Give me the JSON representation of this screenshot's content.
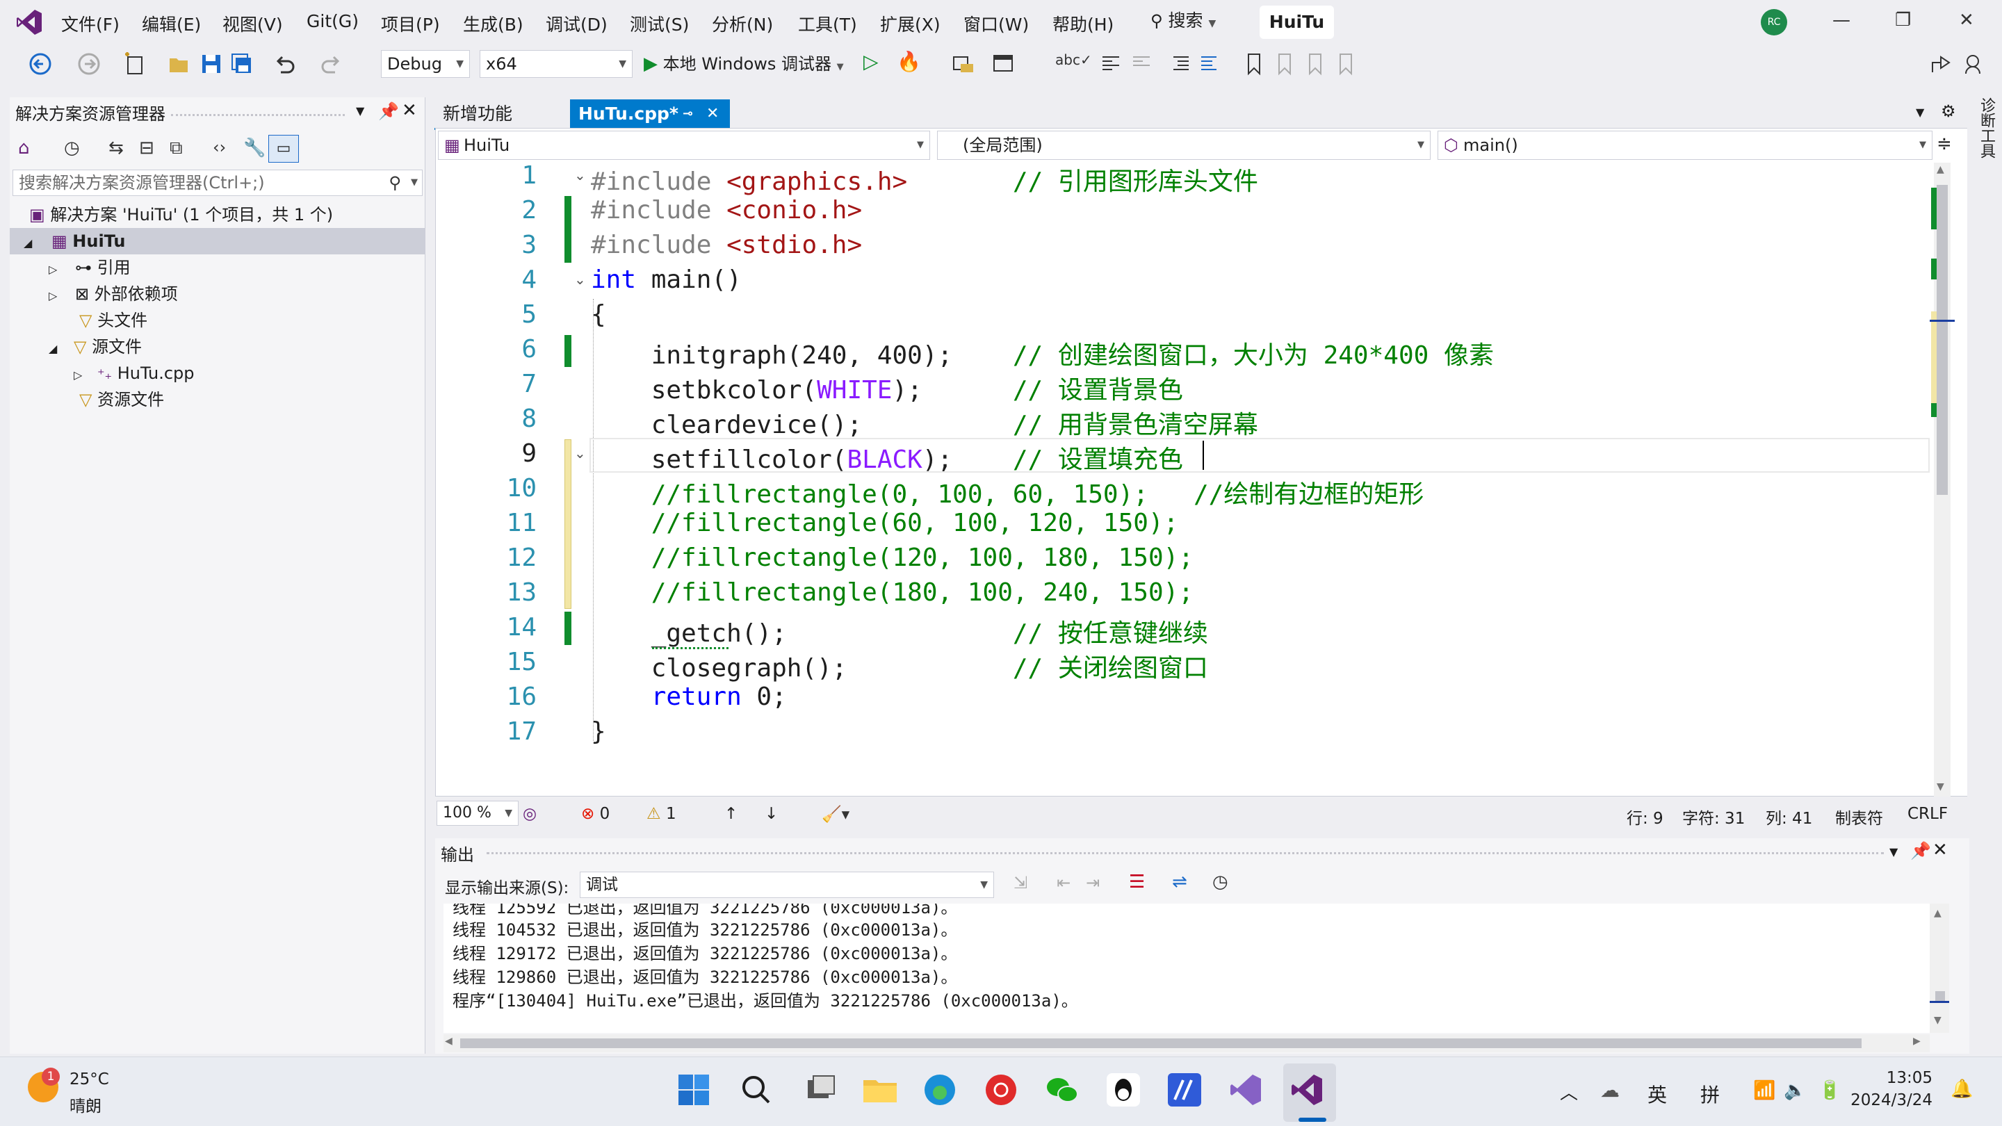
{
  "menu": [
    "文件(F)",
    "编辑(E)",
    "视图(V)",
    "Git(G)",
    "项目(P)",
    "生成(B)",
    "调试(D)",
    "测试(S)",
    "分析(N)",
    "工具(T)",
    "扩展(X)",
    "窗口(W)",
    "帮助(H)"
  ],
  "search_label": "搜索",
  "solution_tab": "HuiTu",
  "avatar": "RC",
  "toolbar": {
    "config": "Debug",
    "platform": "x64",
    "run_label": "本地 Windows 调试器"
  },
  "solution_explorer": {
    "title": "解决方案资源管理器",
    "search_placeholder": "搜索解决方案资源管理器(Ctrl+;)",
    "tree": [
      {
        "label": "解决方案 'HuiTu' (1 个项目，共 1 个)",
        "indent": 0
      },
      {
        "label": "HuiTu",
        "indent": 1
      },
      {
        "label": "引用",
        "indent": 2
      },
      {
        "label": "外部依赖项",
        "indent": 2
      },
      {
        "label": "头文件",
        "indent": 2
      },
      {
        "label": "源文件",
        "indent": 2
      },
      {
        "label": "HuTu.cpp",
        "indent": 3
      },
      {
        "label": "资源文件",
        "indent": 2
      }
    ]
  },
  "tabs": {
    "inactive": "新增功能",
    "active": "HuTu.cpp*"
  },
  "navbar": {
    "project": "HuiTu",
    "scope": "(全局范围)",
    "member": "main()"
  },
  "side_tool": "诊断工具",
  "code_lines": [
    {
      "n": "1",
      "html": "<span class='pp'>#include</span> <span class='str'>&lt;graphics.h&gt;</span>       <span class='cm'>// 引用图形库头文件</span>"
    },
    {
      "n": "2",
      "html": "<span class='pp'>#include</span> <span class='str'>&lt;conio.h&gt;</span>"
    },
    {
      "n": "3",
      "html": "<span class='pp'>#include</span> <span class='str'>&lt;stdio.h&gt;</span>"
    },
    {
      "n": "4",
      "html": "<span class='kw'>int</span> main()"
    },
    {
      "n": "5",
      "html": "{"
    },
    {
      "n": "6",
      "html": "    initgraph(240, 400);    <span class='cm'>// 创建绘图窗口，大小为 240*400 像素</span>"
    },
    {
      "n": "7",
      "html": "    setbkcolor(<span class='mac'>WHITE</span>);      <span class='cm'>// 设置背景色</span>"
    },
    {
      "n": "8",
      "html": "    cleardevice();          <span class='cm'>// 用背景色清空屏幕</span>"
    },
    {
      "n": "9",
      "html": "    setfillcolor(<span class='mac'>BLACK</span>);    <span class='cm'>// 设置填充色</span>"
    },
    {
      "n": "10",
      "html": "    <span class='cm'>//fillrectangle(0, 100, 60, 150);   //绘制有边框的矩形</span>"
    },
    {
      "n": "11",
      "html": "    <span class='cm'>//fillrectangle(60, 100, 120, 150);</span>"
    },
    {
      "n": "12",
      "html": "    <span class='cm'>//fillrectangle(120, 100, 180, 150);</span>"
    },
    {
      "n": "13",
      "html": "    <span class='cm'>//fillrectangle(180, 100, 240, 150);</span>"
    },
    {
      "n": "14",
      "html": "    _getch();               <span class='cm'>// 按任意键继续</span>"
    },
    {
      "n": "15",
      "html": "    closegraph();           <span class='cm'>// 关闭绘图窗口</span>"
    },
    {
      "n": "16",
      "html": "    <span class='kw'>return</span> 0;"
    },
    {
      "n": "17",
      "html": "}"
    }
  ],
  "status": {
    "zoom": "100 %",
    "errors": "0",
    "warnings": "1",
    "line": "行: 9",
    "char": "字符: 31",
    "col": "列: 41",
    "tab": "制表符",
    "eol": "CRLF"
  },
  "output": {
    "title": "输出",
    "source_label": "显示输出来源(S):",
    "source_value": "调试",
    "lines": [
      "线程 104532 已退出，返回值为 3221225786 (0xc000013a)。",
      "线程 129172 已退出，返回值为 3221225786 (0xc000013a)。",
      "线程 129860 已退出，返回值为 3221225786 (0xc000013a)。",
      "程序“[130404] HuiTu.exe”已退出，返回值为 3221225786 (0xc000013a)。"
    ]
  },
  "taskbar": {
    "weather_temp": "25°C",
    "weather_desc": "晴朗",
    "weather_badge": "1",
    "ime1": "英",
    "ime2": "拼",
    "time": "13:05",
    "date": "2024/3/24"
  },
  "colors": {
    "accent": "#007acc",
    "vs_purple": "#68217a",
    "green_change": "#108d2d"
  }
}
